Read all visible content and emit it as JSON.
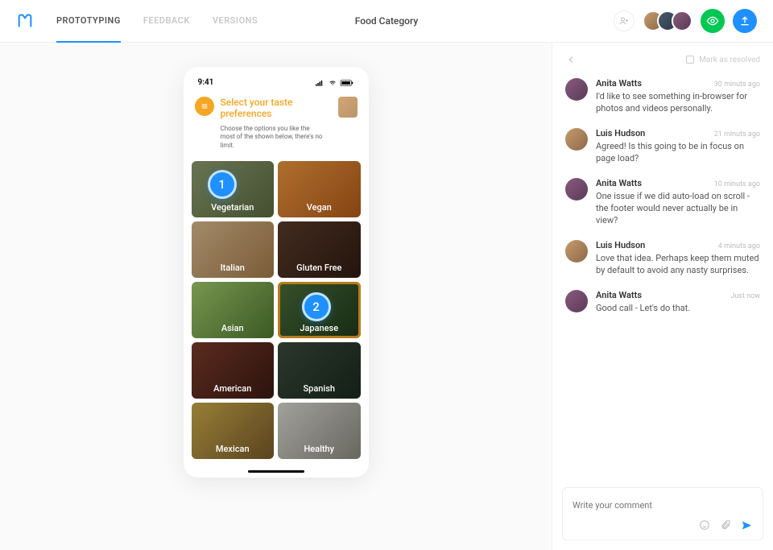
{
  "header": {
    "tabs": [
      "PROTOTYPING",
      "FEEDBACK",
      "VERSIONS"
    ],
    "active_tab": 0,
    "page_title": "Food Category"
  },
  "colors": {
    "accent": "#1E90FF",
    "highlight": "#f5a623",
    "success": "#00C853"
  },
  "prototype": {
    "status_time": "9:41",
    "title": "Select your taste preferences",
    "subtitle": "Choose the options you like the most of the shown below, there's no limit.",
    "cards": [
      {
        "label": "Vegetarian",
        "bg": "bg-vegetarian",
        "selected": false
      },
      {
        "label": "Vegan",
        "bg": "bg-vegan",
        "selected": false
      },
      {
        "label": "Italian",
        "bg": "bg-italian",
        "selected": false
      },
      {
        "label": "Gluten Free",
        "bg": "bg-gluten",
        "selected": false
      },
      {
        "label": "Asian",
        "bg": "bg-asian",
        "selected": false
      },
      {
        "label": "Japanese",
        "bg": "bg-japanese",
        "selected": true
      },
      {
        "label": "American",
        "bg": "bg-american",
        "selected": false
      },
      {
        "label": "Spanish",
        "bg": "bg-spanish",
        "selected": false
      },
      {
        "label": "Mexican",
        "bg": "bg-mexican",
        "selected": false
      },
      {
        "label": "Healthy",
        "bg": "bg-healthy",
        "selected": false
      }
    ],
    "markers": [
      "1",
      "2"
    ]
  },
  "sidebar": {
    "resolve_label": "Mark as resolved",
    "composer_placeholder": "Write your comment",
    "comments": [
      {
        "name": "Anita Watts",
        "time": "30 minuts ago",
        "text": "I'd like to see something in-browser for photos and videos personally.",
        "avatar": "av-a"
      },
      {
        "name": "Luis Hudson",
        "time": "21 minuts ago",
        "text": "Agreed! Is this going to be in focus on page load?",
        "avatar": "av-b"
      },
      {
        "name": "Anita Watts",
        "time": "10 minuts ago",
        "text": "One issue if we did auto-load on scroll - the footer would never actually be in view?",
        "avatar": "av-a"
      },
      {
        "name": "Luis Hudson",
        "time": "4 minuts ago",
        "text": "Love that idea. Perhaps keep them muted by default to avoid any nasty surprises.",
        "avatar": "av-b"
      },
      {
        "name": "Anita Watts",
        "time": "Just now",
        "text": "Good call - Let's do that.",
        "avatar": "av-a"
      }
    ]
  }
}
